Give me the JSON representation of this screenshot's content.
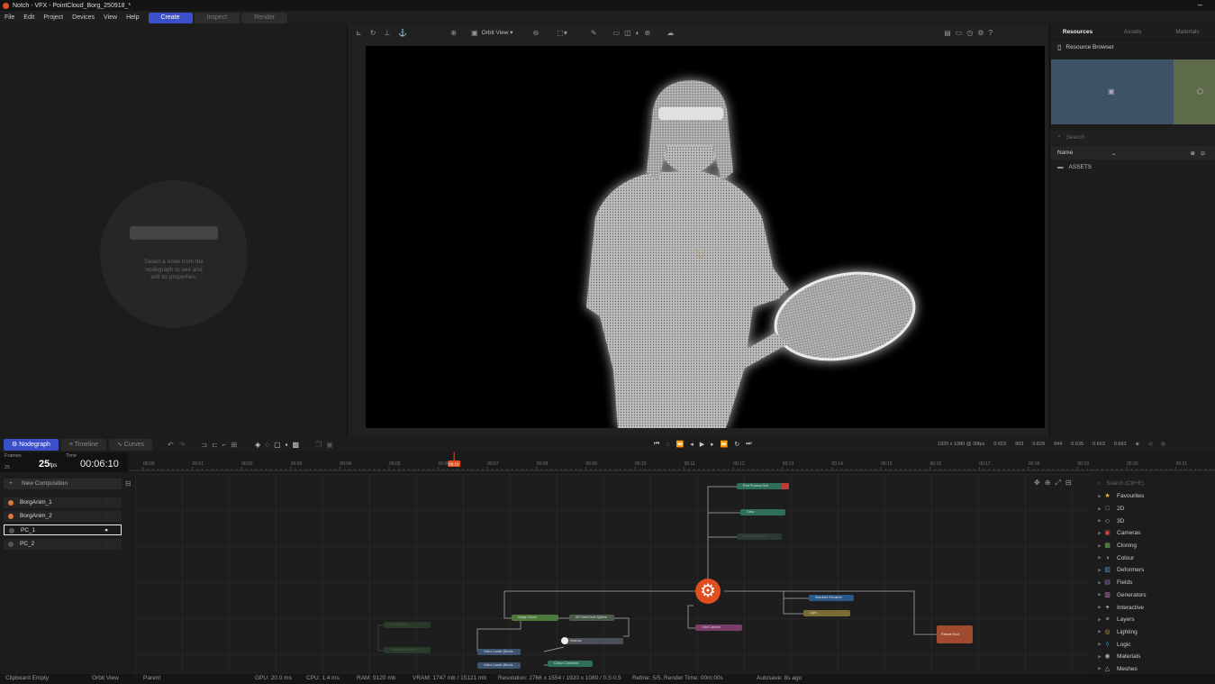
{
  "window": {
    "title": "Notch - VFX - PointCloud_Borg_250918_*",
    "close": "–"
  },
  "menu": {
    "items": [
      "File",
      "Edit",
      "Project",
      "Devices",
      "View",
      "Help"
    ],
    "modes": [
      "Create",
      "Inspect",
      "Render"
    ]
  },
  "properties": {
    "empty_message": "Select a node from the\nnodegraph to see and\nedit its properties."
  },
  "viewport": {
    "view_mode": "Orbit View",
    "icons": [
      "axis-icon",
      "rotate-icon",
      "move-icon",
      "anchor-icon",
      "target-icon",
      "camera-icon",
      "zoom-icon",
      "select-icon",
      "brush-icon"
    ]
  },
  "resources": {
    "tabs": [
      "Resources",
      "Assets",
      "Materials"
    ],
    "browser_label": "Resource Browser",
    "search_placeholder": "Search",
    "sort_label": "Name",
    "folder": "ASSETS"
  },
  "timeline": {
    "tabs": [
      "Nodegraph",
      "Timeline",
      "Curves"
    ],
    "frames_label": "Frames",
    "frames_value": "25",
    "fps": "25",
    "fps_unit": "fps",
    "time_label": "Time",
    "timecode": "00:06:10",
    "ruler_labels": [
      "00:00",
      "00:01",
      "00:02",
      "00:03",
      "00:04",
      "00:05",
      "00:06",
      "00:07",
      "00:08",
      "00:09",
      "00:10",
      "00:11",
      "00:12",
      "00:13",
      "00:14",
      "00:15",
      "00:16",
      "00:17",
      "00:18",
      "00:19",
      "00:20",
      "00:21"
    ],
    "playhead_label": "06:10",
    "playhead_fraction": 0.295
  },
  "stats": {
    "resolution": "1920 x 1080 @ 30fps",
    "a": "0.653",
    "b": "903",
    "c": "0.829",
    "d": "844",
    "e": "0.635",
    "f": "0.663",
    "g": "0.663"
  },
  "compositions": {
    "new_label": "New Composition",
    "layers": [
      {
        "name": "BorgAnim_1",
        "color": "#e07a3a",
        "selected": false
      },
      {
        "name": "BorgAnim_2",
        "color": "#e07a3a",
        "selected": false
      },
      {
        "name": "PC_1",
        "color": "#555555",
        "selected": true
      },
      {
        "name": "PC_2",
        "color": "#555555",
        "selected": false
      }
    ]
  },
  "nodes": [
    {
      "id": "post-process-roll",
      "label": "Post Process Roll",
      "color": "#2f6e5a"
    },
    {
      "id": "glow",
      "label": "Glow",
      "color": "#2f6e5a"
    },
    {
      "id": "dim-node-1",
      "label": "Selection Image",
      "color": "#2a3a33"
    },
    {
      "id": "standard-renderer",
      "label": "Standard Renderer",
      "color": "#2b5a8a"
    },
    {
      "id": "light",
      "label": "Light",
      "color": "#7a6d33"
    },
    {
      "id": "orbit-camera",
      "label": "Orbit Camera",
      "color": "#7a3c68"
    },
    {
      "id": "image-cloner",
      "label": "Image Cloner",
      "color": "#4d7a3a"
    },
    {
      "id": "pointclone-sphere",
      "label": "3D PointClone Sphere",
      "color": "#4a5a4a"
    },
    {
      "id": "material",
      "label": "Material",
      "color": "#4a4f55"
    },
    {
      "id": "video-loader-1",
      "label": "Video Loader (Borda...",
      "color": "#3d5370"
    },
    {
      "id": "video-loader-2",
      "label": "Video Loader (Borda...",
      "color": "#3d5370"
    },
    {
      "id": "colour-correction",
      "label": "Colour Correction",
      "color": "#2f6e5a"
    },
    {
      "id": "particle-root",
      "label": "Particle Root",
      "color": "#a04a30"
    },
    {
      "id": "dim-node-2",
      "label": "Field Affector",
      "color": "#2a3a2a"
    },
    {
      "id": "dim-node-3",
      "label": "Transform Modifier",
      "color": "#2a3a2a"
    }
  ],
  "library": {
    "search_placeholder": "Search (Ctrl+E)",
    "categories": [
      {
        "name": "Favourites",
        "icon": "★",
        "color": "#e8b53a"
      },
      {
        "name": "2D",
        "icon": "□",
        "color": "#aaaaaa"
      },
      {
        "name": "3D",
        "icon": "◇",
        "color": "#aaaaaa"
      },
      {
        "name": "Cameras",
        "icon": "▣",
        "color": "#d04a4a"
      },
      {
        "name": "Cloning",
        "icon": "▦",
        "color": "#6ab04a"
      },
      {
        "name": "Colour",
        "icon": "◑",
        "color": "#aaaaaa"
      },
      {
        "name": "Deformers",
        "icon": "▧",
        "color": "#4a9ad0"
      },
      {
        "name": "Fields",
        "icon": "▤",
        "color": "#a06ad0"
      },
      {
        "name": "Generators",
        "icon": "▥",
        "color": "#d07ad0"
      },
      {
        "name": "Interactive",
        "icon": "✦",
        "color": "#aaaaaa"
      },
      {
        "name": "Layers",
        "icon": "≡",
        "color": "#aaaaaa"
      },
      {
        "name": "Lighting",
        "icon": "◎",
        "color": "#d0b04a"
      },
      {
        "name": "Logic",
        "icon": "◊",
        "color": "#4aa0d0"
      },
      {
        "name": "Materials",
        "icon": "◉",
        "color": "#aaaaaa"
      },
      {
        "name": "Meshes",
        "icon": "△",
        "color": "#aaaaaa"
      }
    ]
  },
  "status": {
    "clipboard": "Clipboard Empty",
    "view": "Orbit View",
    "parent": "Parent",
    "gpu": "GPU: 20.0 ms",
    "cpu": "CPU: 1.4 ms",
    "ram": "RAM: 9120 mb",
    "vram": "VRAM: 1747 mb / 15121 mb",
    "resolution": "Resolution: 2766 x 1554 / 1920 x 1080 / 0.5:0.5",
    "refine": "Refine: 5/5, Render Time: 00m:00s",
    "autosave": "Autosave: 8s ago"
  }
}
